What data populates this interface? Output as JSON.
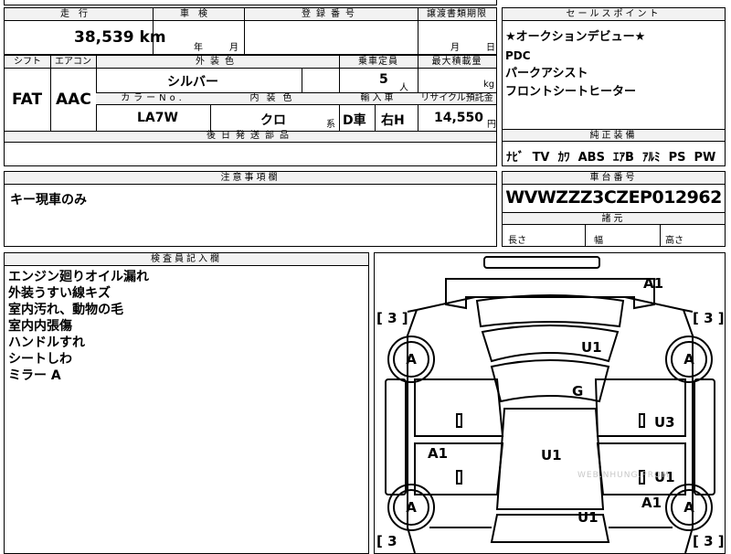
{
  "top_row": {
    "mileage_label": "走行",
    "mileage_value": "38,539 km",
    "inspection_label": "車検",
    "inspection_year": "年",
    "inspection_month": "月",
    "registration_label": "登録番号",
    "transfer_label": "譲渡書類期限",
    "transfer_month": "月",
    "transfer_day": "日"
  },
  "second_row": {
    "shift_label": "シフト",
    "shift_value": "FAT",
    "ac_label": "エアコン",
    "ac_value": "AAC",
    "exterior_label": "外装色",
    "exterior_value": "シルバー",
    "capacity_label": "乗車定員",
    "capacity_value": "5",
    "capacity_unit": "人",
    "load_label": "最大積載量",
    "load_unit": "kg",
    "colorno_label": "カラーNo.",
    "colorno_value": "LA7W",
    "interior_label": "内装色",
    "interior_value": "クロ",
    "interior_suffix": "系",
    "import_label": "輸入車",
    "import_value_1": "D車",
    "import_value_2": "右H",
    "recycle_label": "リサイクル預託金",
    "recycle_value": "14,550",
    "recycle_unit": "円"
  },
  "later_parts_label": "後日発送部品",
  "sales_points": {
    "header": "セールスポイント",
    "lines": [
      "★オークションデビュー★",
      "PDC",
      "パークアシスト",
      "フロントシートヒーター"
    ]
  },
  "equipment": {
    "header": "純正装備",
    "items": [
      "ﾅﾋﾞ",
      "TV",
      "ｶﾜ",
      "ABS",
      "ｴｱB",
      "ｱﾙﾐ",
      "PS",
      "PW"
    ]
  },
  "notes": {
    "header": "注意事項欄",
    "text": "キー現車のみ"
  },
  "chassis": {
    "header": "車台番号",
    "value": "WVWZZZ3CZEP012962",
    "dims_header": "諸元",
    "length_label": "長さ",
    "width_label": "幅",
    "height_label": "高さ"
  },
  "inspector": {
    "header": "検査員記入欄",
    "lines": [
      "エンジン廻りオイル漏れ",
      "外装うすい線キズ",
      "室内汚れ、動物の毛",
      "室内内張傷",
      "ハンドルすれ",
      "シートしわ",
      "ミラー A"
    ]
  },
  "diagram": {
    "marks": {
      "a1_top": "A1",
      "u1_roof": "U1",
      "g_windshield": "G",
      "u3_right": "U3",
      "a1_left": "A1",
      "u1_center": "U1",
      "u1_right": "U1",
      "a1_rear_right": "A1",
      "u1_rear": "U1"
    },
    "tires": [
      "A",
      "A",
      "A",
      "A"
    ],
    "tire_brackets": [
      "[ 3 ]",
      "[ 3 ]",
      "[ 3",
      "[ 3 ]"
    ],
    "watermark": "WEB.NHUNG.PROM"
  }
}
